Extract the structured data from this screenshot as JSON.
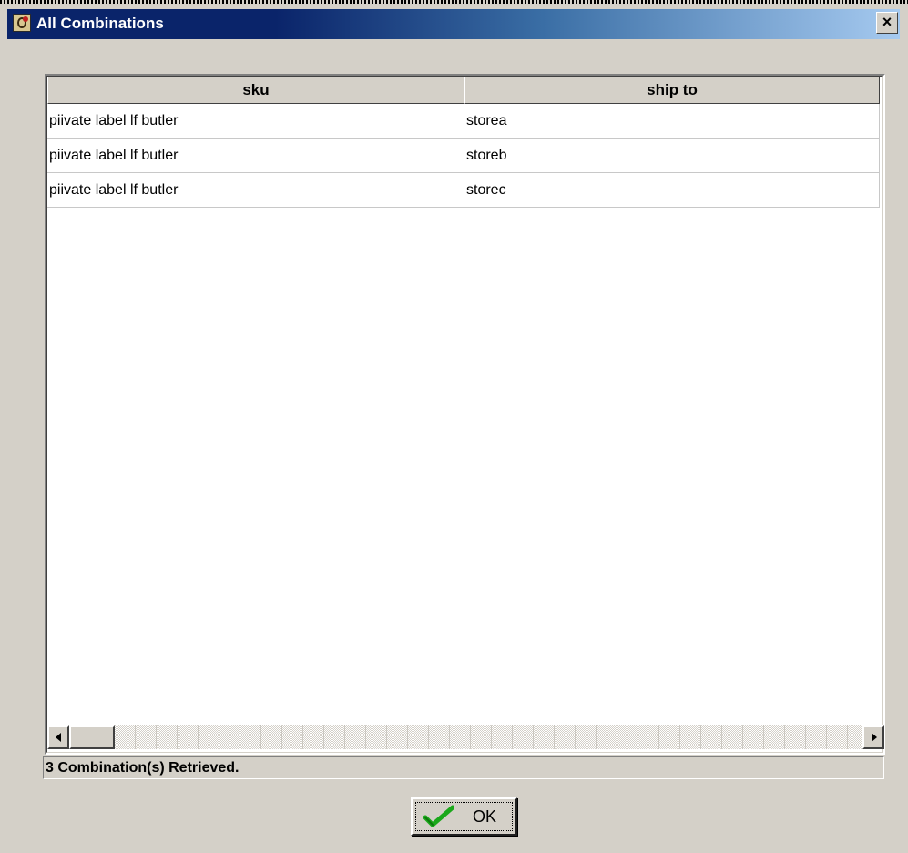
{
  "window": {
    "title": "All Combinations",
    "close_label": "×"
  },
  "table": {
    "columns": [
      "sku",
      "ship to"
    ],
    "rows": [
      {
        "sku": "piivate label lf butler",
        "ship_to": "storea"
      },
      {
        "sku": "piivate label lf butler",
        "ship_to": "storeb"
      },
      {
        "sku": "piivate label lf butler",
        "ship_to": "storec"
      }
    ]
  },
  "status": {
    "text": "3 Combination(s) Retrieved."
  },
  "buttons": {
    "ok_label": "OK"
  },
  "colors": {
    "titlebar_start": "#0a246a",
    "titlebar_end": "#a6caf0",
    "window_bg": "#d4d0c8",
    "check_green": "#1aa81a"
  },
  "icons": {
    "app": "app-icon",
    "close": "close-icon",
    "scroll_left": "arrow-left-icon",
    "scroll_right": "arrow-right-icon",
    "ok": "checkmark-icon"
  }
}
